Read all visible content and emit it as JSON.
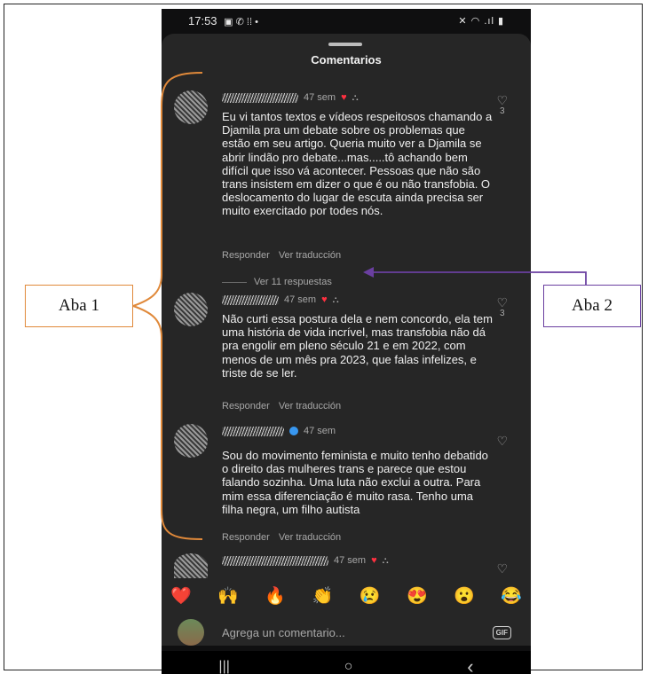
{
  "status": {
    "time": "17:53",
    "left_icons": "▣ ✆ ⁞⁞ •",
    "right_icons": "✕ ◠ .ıl ▮"
  },
  "sheet": {
    "title": "Comentarios"
  },
  "comments": [
    {
      "time": "47 sem",
      "text": "Eu vi tantos textos e vídeos respeitosos chamando a Djamila pra um debate sobre os problemas que estão em seu artigo. Queria muito ver a Djamila se abrir lindão pro debate...mas.....tô achando bem difícil que isso vá acontecer. Pessoas que não são trans insistem em dizer o que é ou não transfobia. O deslocamento do lugar de escuta ainda precisa ser muito exercitado por todes nós.",
      "likes": "3",
      "reply": "Responder",
      "translate": "Ver traducción"
    },
    {
      "time": "47 sem",
      "text": "Não curti essa postura dela e nem concordo, ela tem uma história de vida incrível, mas transfobia não dá pra engolir em pleno século 21 e em 2022, com menos de um mês pra 2023, que falas infelizes, e triste de se ler.",
      "likes": "3",
      "reply": "Responder",
      "translate": "Ver traducción"
    },
    {
      "time": "47 sem",
      "text": "Sou do movimento feminista e muito tenho debatido o direito das mulheres trans e parece que estou falando sozinha. Uma luta não exclui a outra. Para mim essa diferenciação é muito rasa. Tenho uma filha negra, um filho autista",
      "likes": "",
      "reply": "Responder",
      "translate": "Ver traducción"
    },
    {
      "time": "47 sem",
      "text": "",
      "likes": "",
      "reply": "",
      "translate": ""
    }
  ],
  "replies_link": "Ver 11 respuestas",
  "emojis": [
    "❤️",
    "🙌",
    "🔥",
    "👏",
    "😢",
    "😍",
    "😮",
    "😂"
  ],
  "input": {
    "placeholder": "Agrega un comentario...",
    "gif": "GIF"
  },
  "nav": {
    "recents": "|||",
    "home": "○",
    "back": "‹"
  },
  "annotations": {
    "aba1": "Aba 1",
    "aba2": "Aba 2"
  },
  "colors": {
    "aba1_accent": "#e0893a",
    "aba2_accent": "#6a3fa0",
    "heart": "#ff3040"
  }
}
